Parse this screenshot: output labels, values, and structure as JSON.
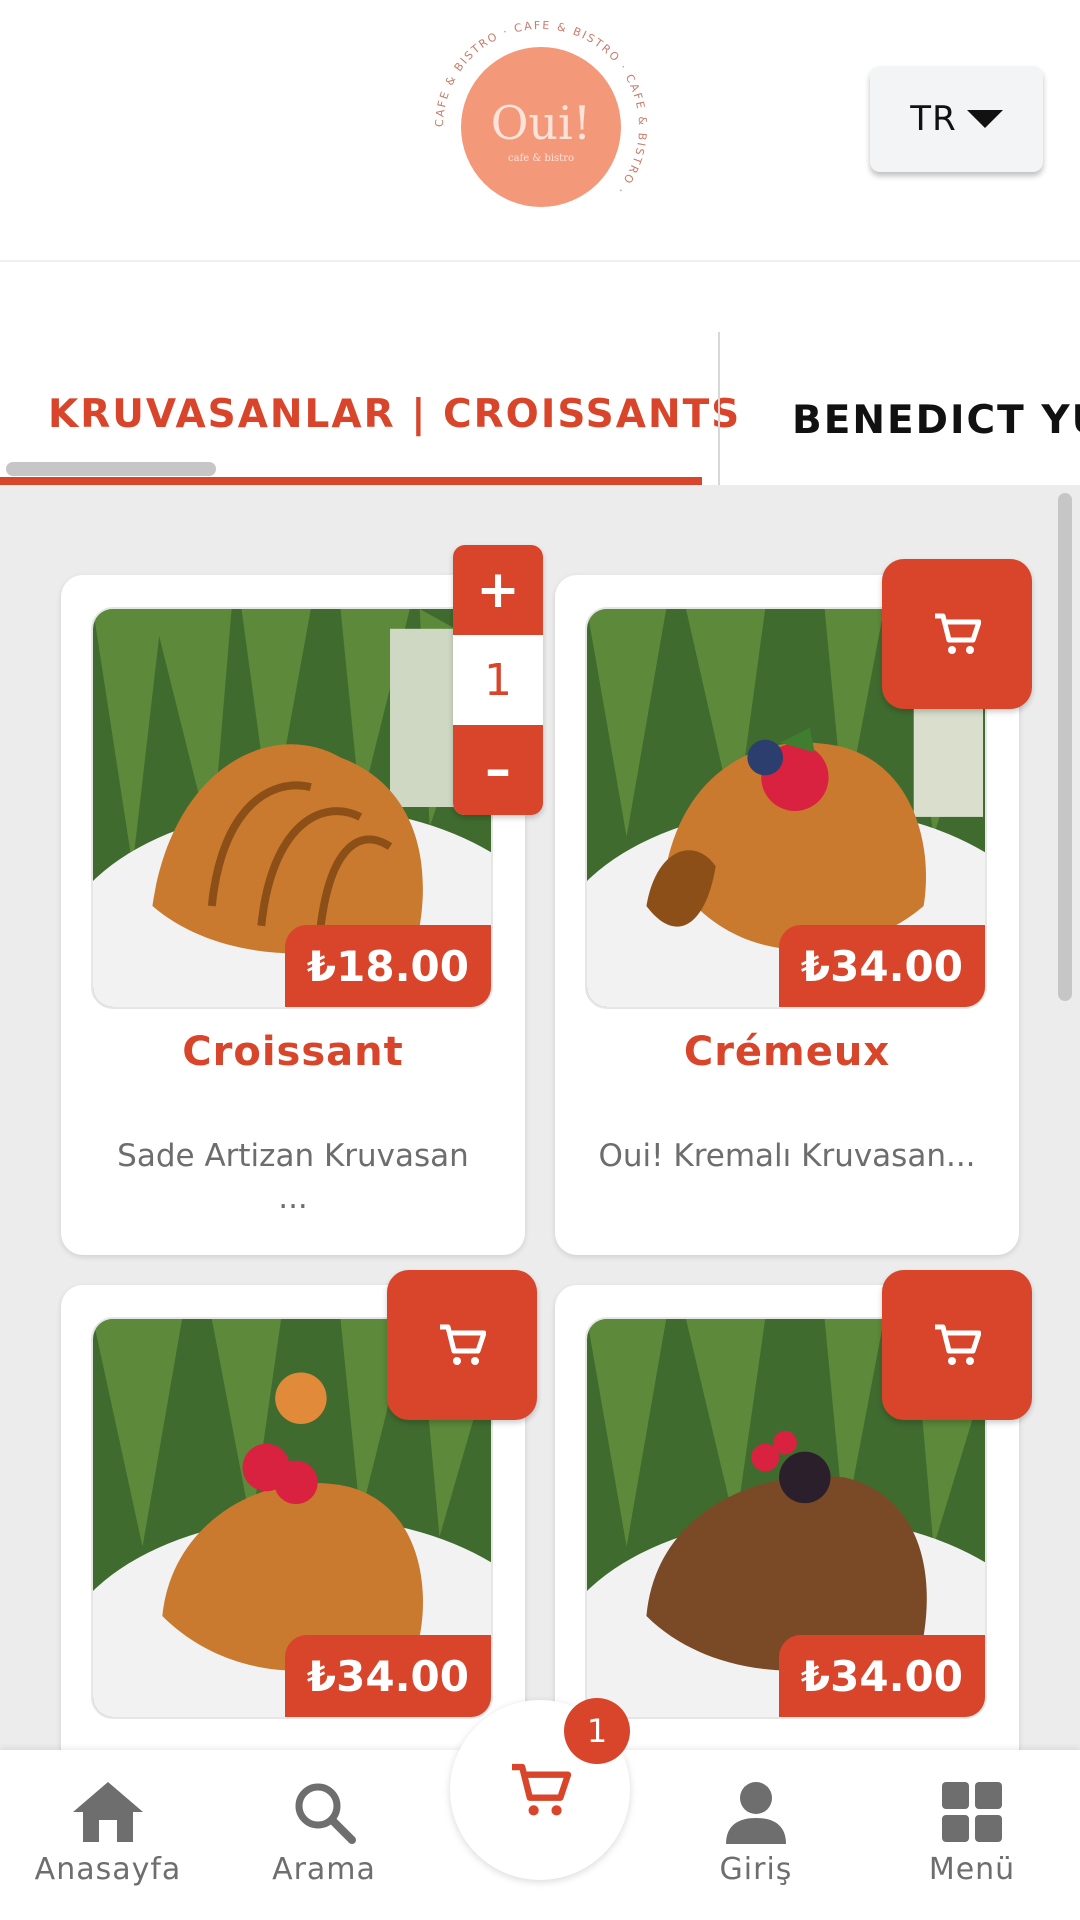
{
  "header": {
    "logo": {
      "main": "Oui!",
      "sub": "cafe & bistro",
      "ring": "CAFE & BISTRO · CAFE & BISTRO · CAFE & BISTRO ·"
    },
    "language": "TR"
  },
  "tabs": {
    "active": "KRUVASANLAR | CROISSANTS",
    "next": "BENEDICT YUM"
  },
  "products": [
    {
      "name": "Croissant",
      "price": "₺18.00",
      "description": "Sade Artizan Kruvasan ...",
      "in_cart_qty": "1"
    },
    {
      "name": "Crémeux",
      "price": "₺34.00",
      "description": "Oui! Kremalı Kruvasan..."
    },
    {
      "name": "",
      "price": "₺34.00",
      "description": ""
    },
    {
      "name": "",
      "price": "₺34.00",
      "description": ""
    }
  ],
  "stepper": {
    "plus": "+",
    "minus": "–",
    "qty": "1"
  },
  "cart_badge": "1",
  "bottom_nav": {
    "home": "Anasayfa",
    "search": "Arama",
    "login": "Giriş",
    "menu": "Menü"
  },
  "colors": {
    "accent": "#d8452a",
    "logo": "#f4987a",
    "nav_gray": "#6e6e6e"
  },
  "icons": {
    "cart": "cart-icon",
    "home": "home-icon",
    "search": "search-icon",
    "user": "user-icon",
    "menu": "grid-icon"
  }
}
